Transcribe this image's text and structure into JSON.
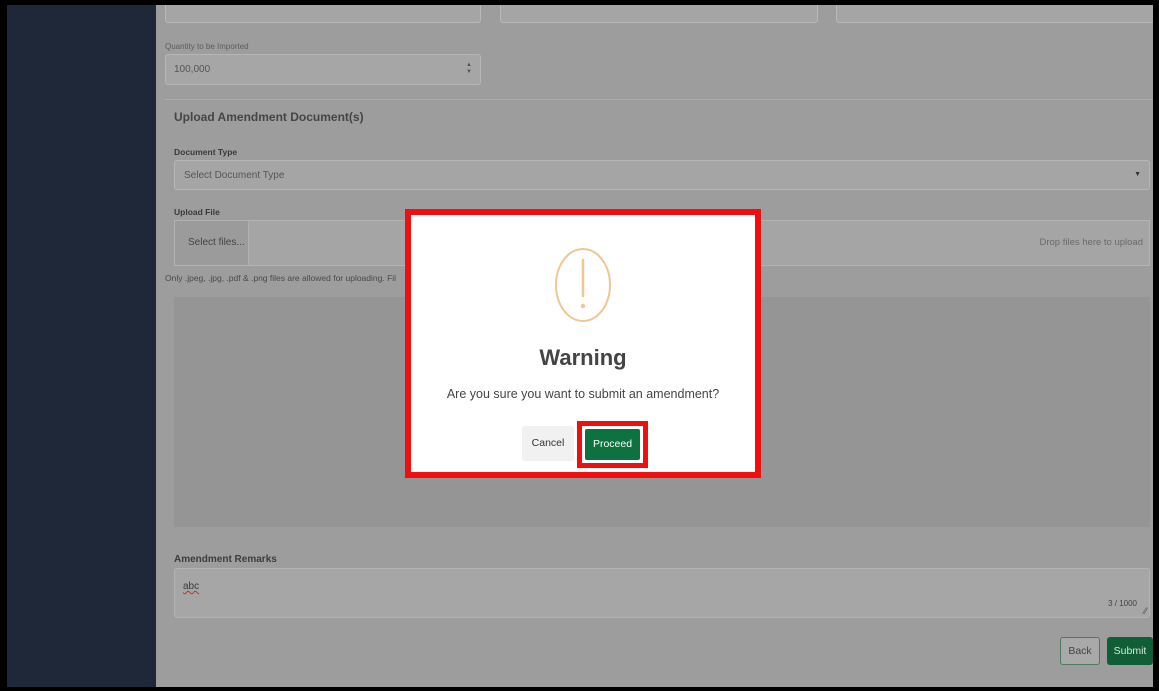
{
  "form": {
    "quantity_label": "Quantity to be Imported",
    "quantity_value": "100,000",
    "upload_section_title": "Upload Amendment Document(s)",
    "document_type_label": "Document Type",
    "document_type_placeholder": "Select Document Type",
    "upload_file_label": "Upload File",
    "select_files_label": "Select files...",
    "drop_files_text": "Drop files here to upload",
    "file_hint": "Only .jpeg, .jpg, .pdf & .png files are allowed for uploading. Fil",
    "remarks_label": "Amendment Remarks",
    "remarks_value": "abc",
    "remarks_counter": "3 / 1000",
    "back_label": "Back",
    "submit_label": "Submit"
  },
  "modal": {
    "title": "Warning",
    "message": "Are you sure you want to submit an amendment?",
    "cancel_label": "Cancel",
    "proceed_label": "Proceed",
    "icon": "warning-icon",
    "icon_color": "#f0c692",
    "highlight_color": "#ff0000",
    "proceed_color": "#0d7240"
  },
  "colors": {
    "sidebar": "#1f2838",
    "submit_button": "#0f5e35"
  }
}
